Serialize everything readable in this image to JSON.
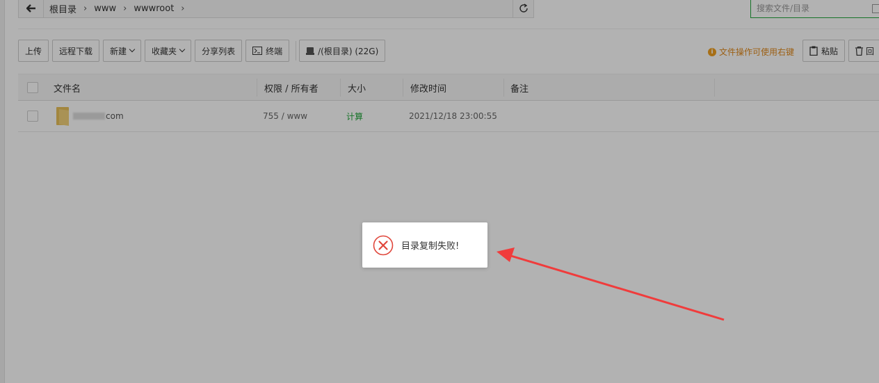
{
  "pathbar": {
    "breadcrumb": [
      "根目录",
      "www",
      "wwwroot"
    ],
    "back_icon": "arrow-left-icon",
    "refresh_icon": "refresh-icon"
  },
  "search": {
    "placeholder": "搜索文件/目录"
  },
  "toolbar": {
    "upload": "上传",
    "remote_download": "远程下载",
    "new": "新建",
    "favorites": "收藏夹",
    "share_list": "分享列表",
    "terminal": "终端",
    "disk": "/(根目录) (22G)"
  },
  "hint": "文件操作可使用右键",
  "right_toolbar": {
    "paste": "粘贴",
    "recycle": "回"
  },
  "table": {
    "headers": {
      "name": "文件名",
      "perm_owner": "权限 / 所有者",
      "size": "大小",
      "modified": "修改时间",
      "note": "备注"
    },
    "rows": [
      {
        "name": "com",
        "perm_owner": "755 / www",
        "size": "计算",
        "modified": "2021/12/18 23:00:55",
        "note": ""
      }
    ]
  },
  "toast": {
    "message": "目录复制失败!",
    "icon": "error-circle-icon"
  },
  "colors": {
    "accent_green": "#20a53a",
    "hint_orange": "#e08a1e",
    "error_red": "#e0463b",
    "annotation_arrow": "#f03c3c"
  }
}
